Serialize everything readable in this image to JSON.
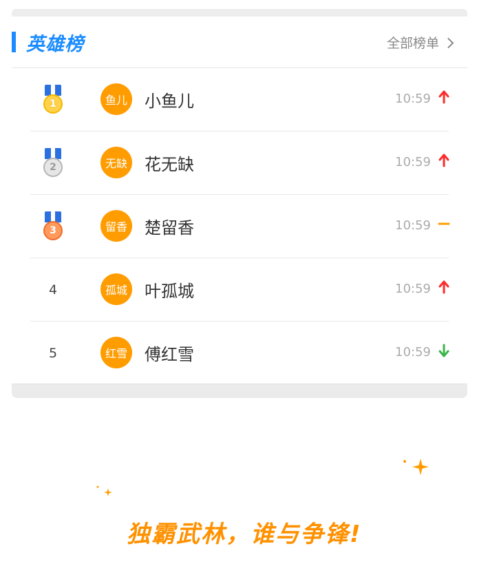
{
  "header": {
    "title": "英雄榜",
    "all_link": "全部榜单"
  },
  "rows": [
    {
      "rank": "1",
      "medal": "gold",
      "avatar": "鱼儿",
      "name": "小鱼儿",
      "time": "10:59",
      "trend": "up"
    },
    {
      "rank": "2",
      "medal": "silver",
      "avatar": "无缺",
      "name": "花无缺",
      "time": "10:59",
      "trend": "up"
    },
    {
      "rank": "3",
      "medal": "bronze",
      "avatar": "留香",
      "name": "楚留香",
      "time": "10:59",
      "trend": "flat"
    },
    {
      "rank": "4",
      "medal": null,
      "avatar": "孤城",
      "name": "叶孤城",
      "time": "10:59",
      "trend": "up"
    },
    {
      "rank": "5",
      "medal": null,
      "avatar": "红雪",
      "name": "傅红雪",
      "time": "10:59",
      "trend": "down"
    }
  ],
  "slogan": "独霸武林，谁与争锋!",
  "colors": {
    "accent": "#1a8cff",
    "avatar": "#ff9c00",
    "up": "#ff2a2a",
    "flat": "#ff9c00",
    "down": "#3bb54a",
    "slogan": "#ff9100"
  },
  "icons": {
    "up": "arrow-up-icon",
    "flat": "dash-icon",
    "down": "arrow-down-icon",
    "medal": "medal-icon",
    "chevron": "chevron-right-icon",
    "sparkle": "sparkle-icon"
  }
}
